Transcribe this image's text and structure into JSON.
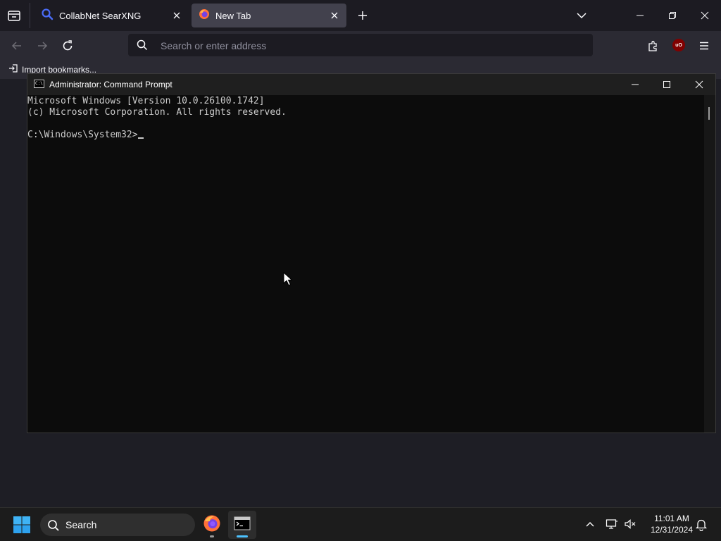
{
  "browser": {
    "tabs": [
      {
        "label": "CollabNet SearXNG",
        "icon": "searxng-icon",
        "active": false
      },
      {
        "label": "New Tab",
        "icon": "firefox-icon",
        "active": true
      }
    ],
    "url_placeholder": "Search or enter address",
    "extension_badge": "uO",
    "bookmarks": {
      "import_label": "Import bookmarks..."
    }
  },
  "cmd_window": {
    "title": "Administrator: Command Prompt",
    "lines": [
      "Microsoft Windows [Version 10.0.26100.1742]",
      "(c) Microsoft Corporation. All rights reserved.",
      "",
      "C:\\Windows\\System32>"
    ]
  },
  "taskbar": {
    "search_label": "Search",
    "clock_time": "11:01 AM",
    "clock_date": "12/31/2024",
    "apps": [
      {
        "name": "firefox-icon",
        "running": true,
        "active": false
      },
      {
        "name": "command-prompt-icon",
        "running": true,
        "active": true
      }
    ]
  },
  "colors": {
    "browser_bg": "#1c1b22",
    "toolbar_bg": "#2b2a33",
    "active_tab_bg": "#42414d",
    "terminal_bg": "#0c0c0c",
    "terminal_text": "#cccccc",
    "taskbar_bg": "#1c1c1c",
    "accent": "#4cc2ff"
  }
}
